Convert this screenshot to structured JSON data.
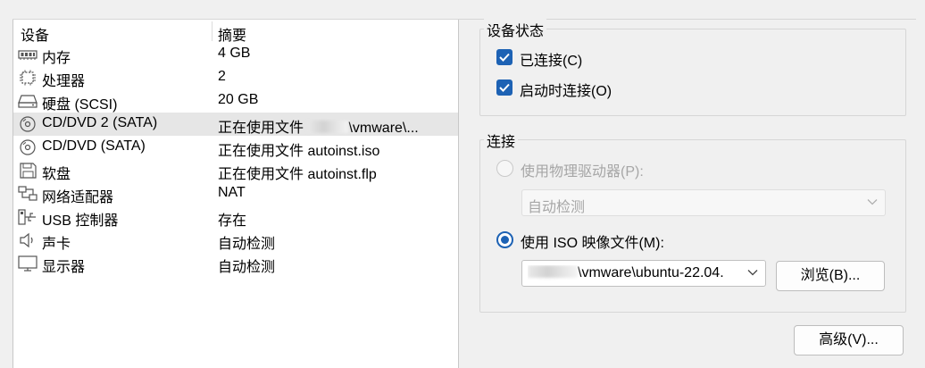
{
  "device_list": {
    "headers": {
      "device": "设备",
      "summary": "摘要"
    },
    "rows": [
      {
        "icon": "memory-icon",
        "name": "内存",
        "summary": "4 GB"
      },
      {
        "icon": "processor-icon",
        "name": "处理器",
        "summary": "2"
      },
      {
        "icon": "hard-disk-icon",
        "name": "硬盘 (SCSI)",
        "summary": "20 GB"
      },
      {
        "icon": "cd-dvd-icon",
        "name": "CD/DVD 2 (SATA)",
        "summary_prefix": "正在使用文件",
        "summary_suffix": "\\vmware\\...",
        "selected": true
      },
      {
        "icon": "cd-dvd-icon",
        "name": "CD/DVD (SATA)",
        "summary": "正在使用文件 autoinst.iso"
      },
      {
        "icon": "floppy-icon",
        "name": "软盘",
        "summary": "正在使用文件 autoinst.flp"
      },
      {
        "icon": "network-adapter-icon",
        "name": "网络适配器",
        "summary": "NAT"
      },
      {
        "icon": "usb-icon",
        "name": "USB 控制器",
        "summary": "存在"
      },
      {
        "icon": "speaker-icon",
        "name": "声卡",
        "summary": "自动检测"
      },
      {
        "icon": "monitor-icon",
        "name": "显示器",
        "summary": "自动检测"
      }
    ]
  },
  "device_status": {
    "title": "设备状态",
    "connected": {
      "label": "已连接(C)",
      "checked": true
    },
    "connect_at_power_on": {
      "label": "启动时连接(O)",
      "checked": true
    }
  },
  "connection": {
    "title": "连接",
    "physical_drive": {
      "label": "使用物理驱动器(P):",
      "selected": false,
      "dropdown_value": "自动检测"
    },
    "iso_image": {
      "label": "使用 ISO 映像文件(M):",
      "selected": true,
      "path_suffix": "\\vmware\\ubuntu-22.04."
    },
    "browse_label": "浏览(B)..."
  },
  "advanced_label": "高级(V)...",
  "colors": {
    "accent": "#1d62b4",
    "selected_row": "#e6e6e6",
    "disabled_text": "#a6a6a6"
  }
}
